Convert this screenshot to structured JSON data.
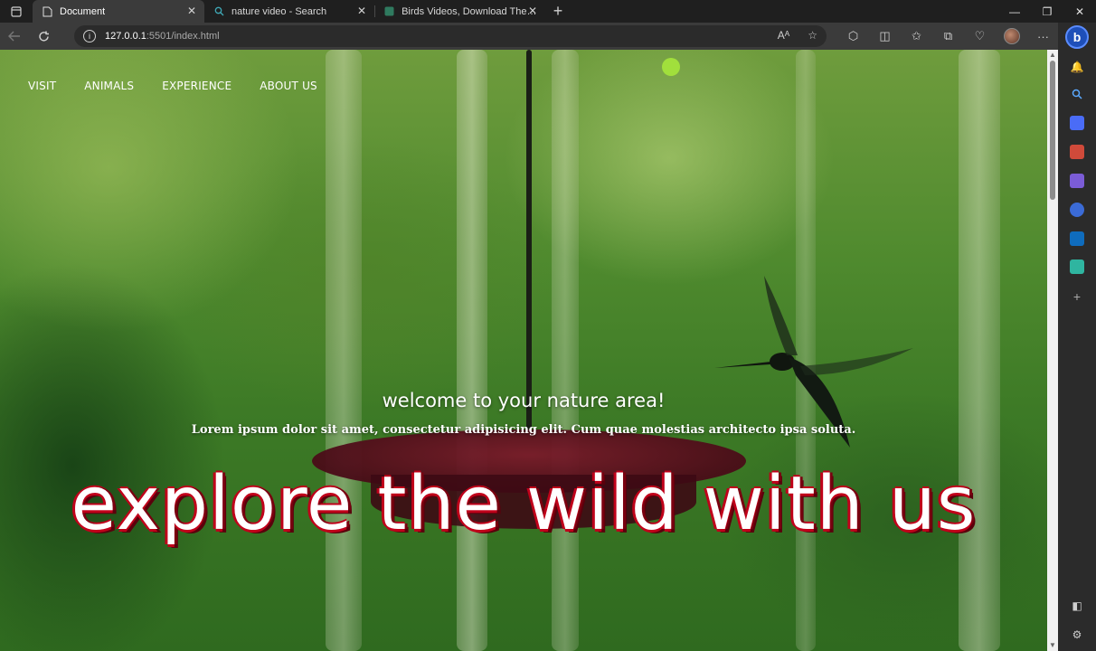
{
  "tabs": [
    {
      "title": "Document",
      "active": true,
      "favicon": "page-icon"
    },
    {
      "title": "nature video - Search",
      "active": false,
      "favicon": "search-icon"
    },
    {
      "title": "Birds Videos, Download The BES",
      "active": false,
      "favicon": "site-icon"
    }
  ],
  "address": {
    "host": "127.0.0.1",
    "rest": ":5501/index.html"
  },
  "site": {
    "nav": [
      "VISIT",
      "ANIMALS",
      "EXPERIENCE",
      "ABOUT US"
    ],
    "welcome": "welcome to your nature area!",
    "lorem": "Lorem ipsum dolor sit amet, consectetur adipisicing elit. Cum quae molestias architecto ipsa soluta.",
    "headline": "explore the wild with us"
  },
  "colors": {
    "accent": "#c0001a",
    "bing": "#1e4fb8"
  }
}
